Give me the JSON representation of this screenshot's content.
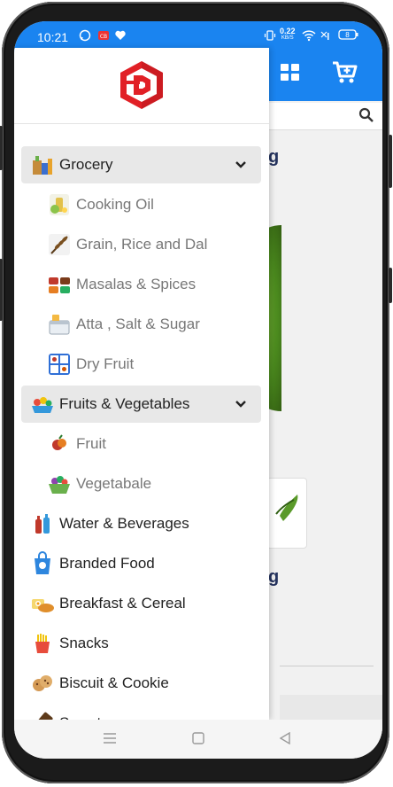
{
  "status_bar": {
    "time": "10:21",
    "network_speed_value": "0.22",
    "network_speed_unit": "KB/S",
    "battery": "8"
  },
  "background": {
    "heading_fragment_1": "g",
    "heading_fragment_2": "g"
  },
  "drawer": {
    "logo_icon": "red-hexagon-d-logo",
    "categories": [
      {
        "label": "Grocery",
        "icon": "grocery-bags-icon",
        "expanded": true,
        "children": [
          {
            "label": "Cooking Oil",
            "icon": "oil-bottle-icon"
          },
          {
            "label": "Grain, Rice and Dal",
            "icon": "wheat-icon"
          },
          {
            "label": "Masalas & Spices",
            "icon": "spices-icon"
          },
          {
            "label": "Atta , Salt & Sugar",
            "icon": "flour-jar-icon"
          },
          {
            "label": "Dry Fruit",
            "icon": "dry-fruit-icon"
          }
        ]
      },
      {
        "label": "Fruits & Vegetables",
        "icon": "fruit-basket-icon",
        "expanded": true,
        "children": [
          {
            "label": "Fruit",
            "icon": "fruit-icon"
          },
          {
            "label": "Vegetabale",
            "icon": "vegetable-basket-icon"
          }
        ]
      },
      {
        "label": "Water & Beverages",
        "icon": "beverage-bottles-icon"
      },
      {
        "label": "Branded Food",
        "icon": "food-bag-icon"
      },
      {
        "label": "Breakfast & Cereal",
        "icon": "breakfast-icon"
      },
      {
        "label": "Snacks",
        "icon": "fries-icon"
      },
      {
        "label": "Biscuit & Cookie",
        "icon": "cookie-icon"
      },
      {
        "label": "Sweets",
        "icon": "chocolate-icon"
      }
    ]
  },
  "colors": {
    "primary": "#1a84f0",
    "drawer_bg": "#ffffff",
    "expanded_row_bg": "#e8e8e8",
    "logo_red": "#e12026"
  }
}
